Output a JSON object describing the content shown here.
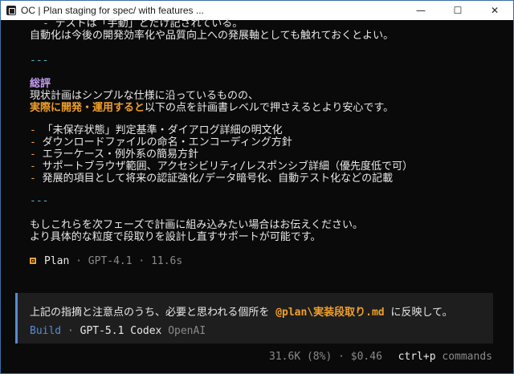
{
  "window": {
    "title": "OC | Plan staging for spec/ with features ...",
    "minimize_glyph": "—",
    "maximize_glyph": "☐",
    "close_glyph": "✕"
  },
  "transcript": {
    "line1_dash": "-",
    "line1_text": "テストは「手動」とだけ記されている。",
    "line2_text": "自動化は今後の開発効率化や品質向上への発展軸としても触れておくとよい。",
    "sep1": "---",
    "heading": "総評",
    "summary1": "現状計画はシンプルな仕様に沿っているものの、",
    "summary2_highlight": "実際に開発・運用すると",
    "summary2_rest": "以下の点を計画書レベルで押さえるとより安心です。",
    "bullets": [
      "「未保存状態」判定基準・ダイアログ詳細の明文化",
      "ダウンロードファイルの命名・エンコーディング方針",
      "エラーケース・例外系の簡易方針",
      "サポートブラウザ範囲、アクセシビリティ/レスポンシブ詳細（優先度低で可）",
      "発展的項目として将来の認証強化/データ暗号化、自動テスト化などの記載"
    ],
    "bullet_dash": "-",
    "sep2": "---",
    "closing1": "もしこれらを次フェーズで計画に組み込みたい場合はお伝えください。",
    "closing2": "より具体的な粒度で段取りを設計し直すサポートが可能です。"
  },
  "plan_meta": {
    "agent": "Plan",
    "dot1": "·",
    "model": "GPT-4.1",
    "dot2": "·",
    "duration": "11.6s"
  },
  "input": {
    "text_before": "上記の指摘と注意点のうち、必要と思われる個所を ",
    "mention": "@plan\\実装段取り.md",
    "text_after": " に反映して。",
    "agent": "Build",
    "dot": "·",
    "model": "GPT-5.1 Codex",
    "provider": "OpenAI"
  },
  "status": {
    "tokens": "31.6K (8%)",
    "dot": "·",
    "cost": "$0.46",
    "shortcut": "ctrl+p",
    "shortcut_label": "commands"
  },
  "colors": {
    "accent_orange": "#f0a02c",
    "heading_purple": "#c59cf2",
    "separator_cyan": "#56b3c6",
    "agent_blue": "#5a8ad6"
  }
}
